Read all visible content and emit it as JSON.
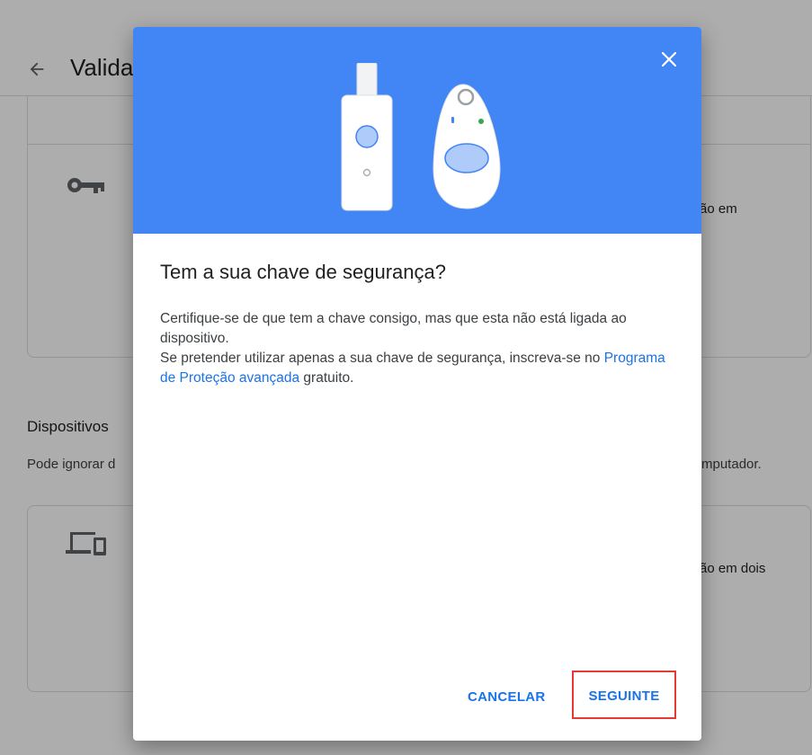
{
  "background": {
    "title": "Valida",
    "card1_right_text": "ão em",
    "section_title": "Dispositivos",
    "section_desc_left": "Pode ignorar d",
    "section_desc_right": "mputador.",
    "card2_right_text": "ão em dois",
    "icons": [
      "back-arrow-icon",
      "key-icon",
      "devices-icon"
    ]
  },
  "dialog": {
    "title": "Tem a sua chave de segurança?",
    "body_line1": "Certifique-se de que tem a chave consigo, mas que esta não está ligada ao dispositivo.",
    "body_line2_before": "Se pretender utilizar apenas a sua chave de segurança, inscreva-se no ",
    "body_link": "Programa de Proteção avançada",
    "body_line2_after": " gratuito.",
    "cancel_label": "CANCELAR",
    "next_label": "SEGUINTE",
    "close_icon": "close-icon",
    "colors": {
      "hero": "#4285f4",
      "accent": "#1a73e8",
      "highlight": "#e53935"
    }
  }
}
